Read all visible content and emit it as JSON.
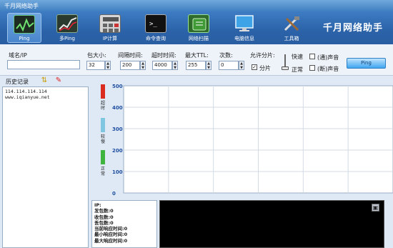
{
  "window": {
    "title": "千月网络助手"
  },
  "toolbar": {
    "items": [
      {
        "label": "Ping",
        "icon": "ping-chart-icon"
      },
      {
        "label": "多Ping",
        "icon": "multi-ping-icon"
      },
      {
        "label": "IP计算",
        "icon": "calculator-icon"
      },
      {
        "label": "命令查询",
        "icon": "terminal-icon"
      },
      {
        "label": "网络扫描",
        "icon": "network-scan-icon"
      },
      {
        "label": "电脑信息",
        "icon": "monitor-icon"
      },
      {
        "label": "工具箱",
        "icon": "tools-icon"
      }
    ],
    "brand": "千月网络助手"
  },
  "controls": {
    "domain_label": "域名/IP",
    "domain_value": "",
    "packet_size_label": "包大小:",
    "packet_size_value": "32",
    "interval_label": "间隔时间:",
    "interval_value": "200",
    "timeout_label": "超时时间:",
    "timeout_value": "4000",
    "ttl_label": "最大TTL:",
    "ttl_value": "255",
    "count_label": "次数:",
    "count_value": "0",
    "allow_fragment_label": "允许分片:",
    "fragment_label": "分片",
    "fragment_checked": true,
    "fast_label": "快速",
    "normal_label": "正常",
    "pass_sound_label": "(通)声音",
    "fail_sound_label": "(断)声音",
    "ping_button": "Ping"
  },
  "history": {
    "label": "历史记录",
    "entries": [
      "114.114.114.114",
      "www.iqianyue.net"
    ]
  },
  "indicators": {
    "timeout_label": "超时",
    "slow_label": "较慢",
    "normal_label": "正常",
    "colors": {
      "timeout": "#d92b1e",
      "slow": "#7fc6e0",
      "normal": "#3fb43f"
    }
  },
  "chart": {
    "yticks": [
      "500",
      "400",
      "300",
      "200",
      "100",
      "0"
    ]
  },
  "chart_data": {
    "type": "line",
    "y_ticks": [
      500,
      400,
      300,
      200,
      100,
      0
    ],
    "ylim": [
      0,
      500
    ],
    "series": [],
    "grid": true
  },
  "stats": {
    "lines": [
      "IP:",
      "发包数:0",
      "收包数:0",
      "丢包数:0",
      "当前响应时间:0",
      "最小响应时间:0",
      "最大响应时间:0"
    ]
  }
}
